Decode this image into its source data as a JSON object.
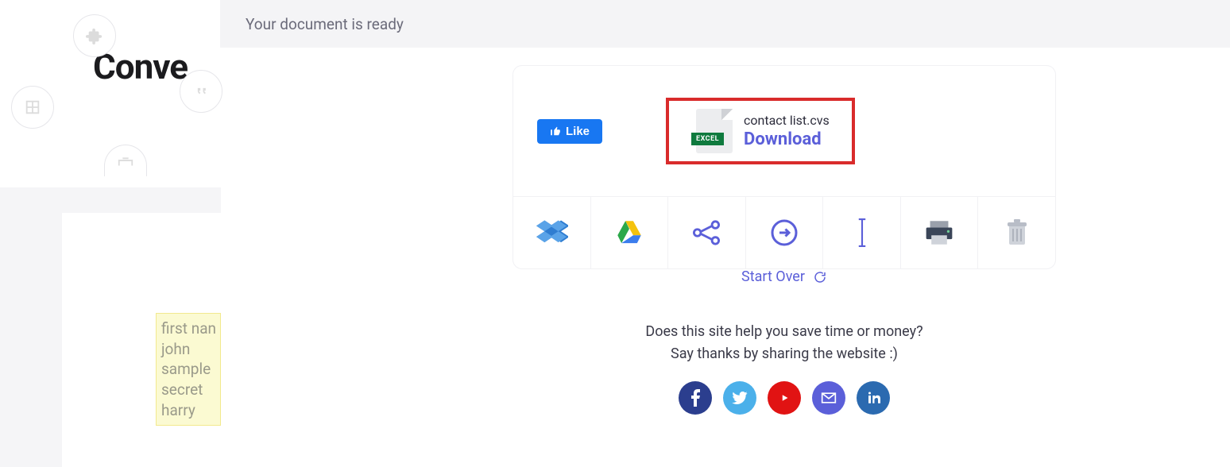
{
  "banner": {
    "message": "Your document is ready"
  },
  "logo": "Conve",
  "download": {
    "filename": "contact list.cvs",
    "action_label": "Download",
    "file_badge": "EXCEL"
  },
  "like_label": "Like",
  "actions": {
    "dropbox": "dropbox-icon",
    "gdrive": "google-drive-icon",
    "share": "share-icon",
    "export": "export-icon",
    "rename": "rename-icon",
    "print": "printer-icon",
    "delete": "trash-icon"
  },
  "start_over_label": "Start Over",
  "pitch": {
    "line1": "Does this site help you save time or money?",
    "line2": "Say thanks by sharing the website :)"
  },
  "preview_rows": [
    "first nan",
    "john",
    "sample",
    "secret",
    "harry"
  ],
  "social": [
    "facebook",
    "twitter",
    "youtube",
    "email",
    "linkedin"
  ]
}
